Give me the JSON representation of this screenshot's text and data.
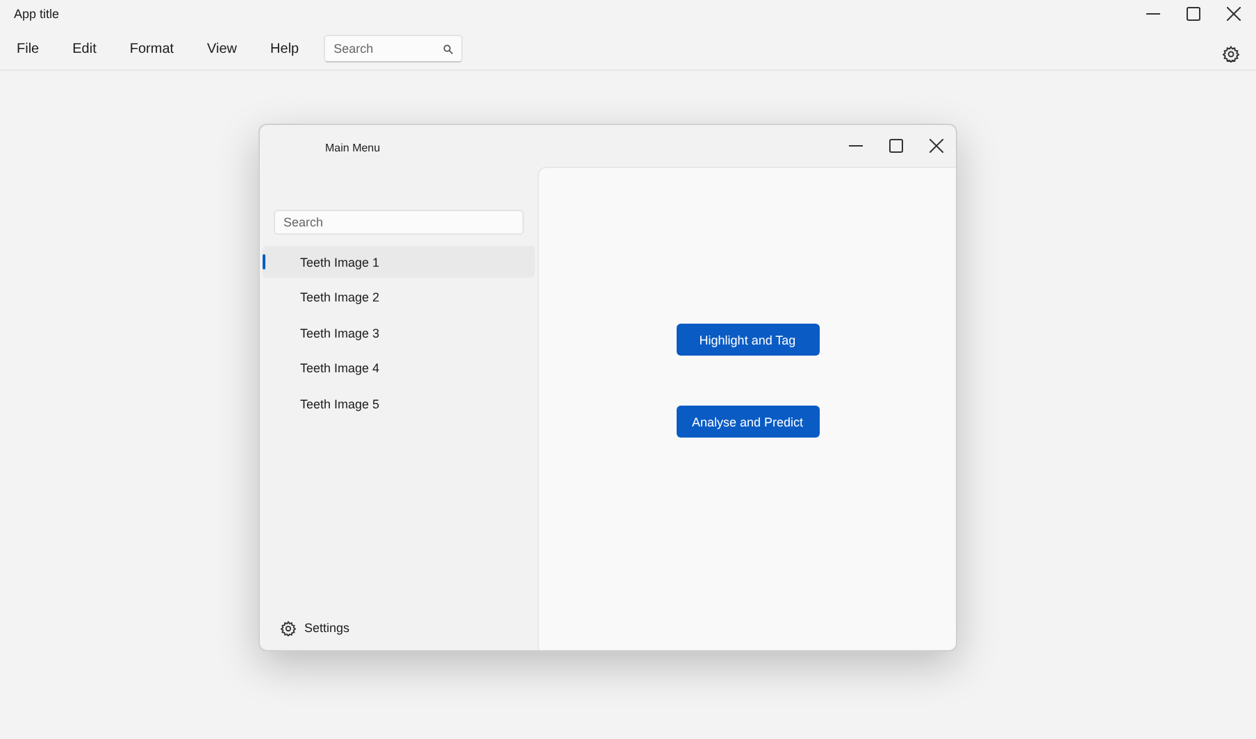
{
  "window": {
    "title": "App title"
  },
  "menu": [
    "File",
    "Edit",
    "Format",
    "View",
    "Help"
  ],
  "search": {
    "placeholder": "Search"
  },
  "dialog": {
    "title": "Main Menu",
    "search": {
      "placeholder": "Search"
    },
    "items": [
      {
        "label": "Teeth Image 1",
        "selected": true
      },
      {
        "label": "Teeth Image 2",
        "selected": false
      },
      {
        "label": "Teeth Image 3",
        "selected": false
      },
      {
        "label": "Teeth Image 4",
        "selected": false
      },
      {
        "label": "Teeth Image 5",
        "selected": false
      }
    ],
    "settings": "Settings",
    "buttons": [
      "Highlight and Tag",
      "Analyse and Predict"
    ]
  }
}
